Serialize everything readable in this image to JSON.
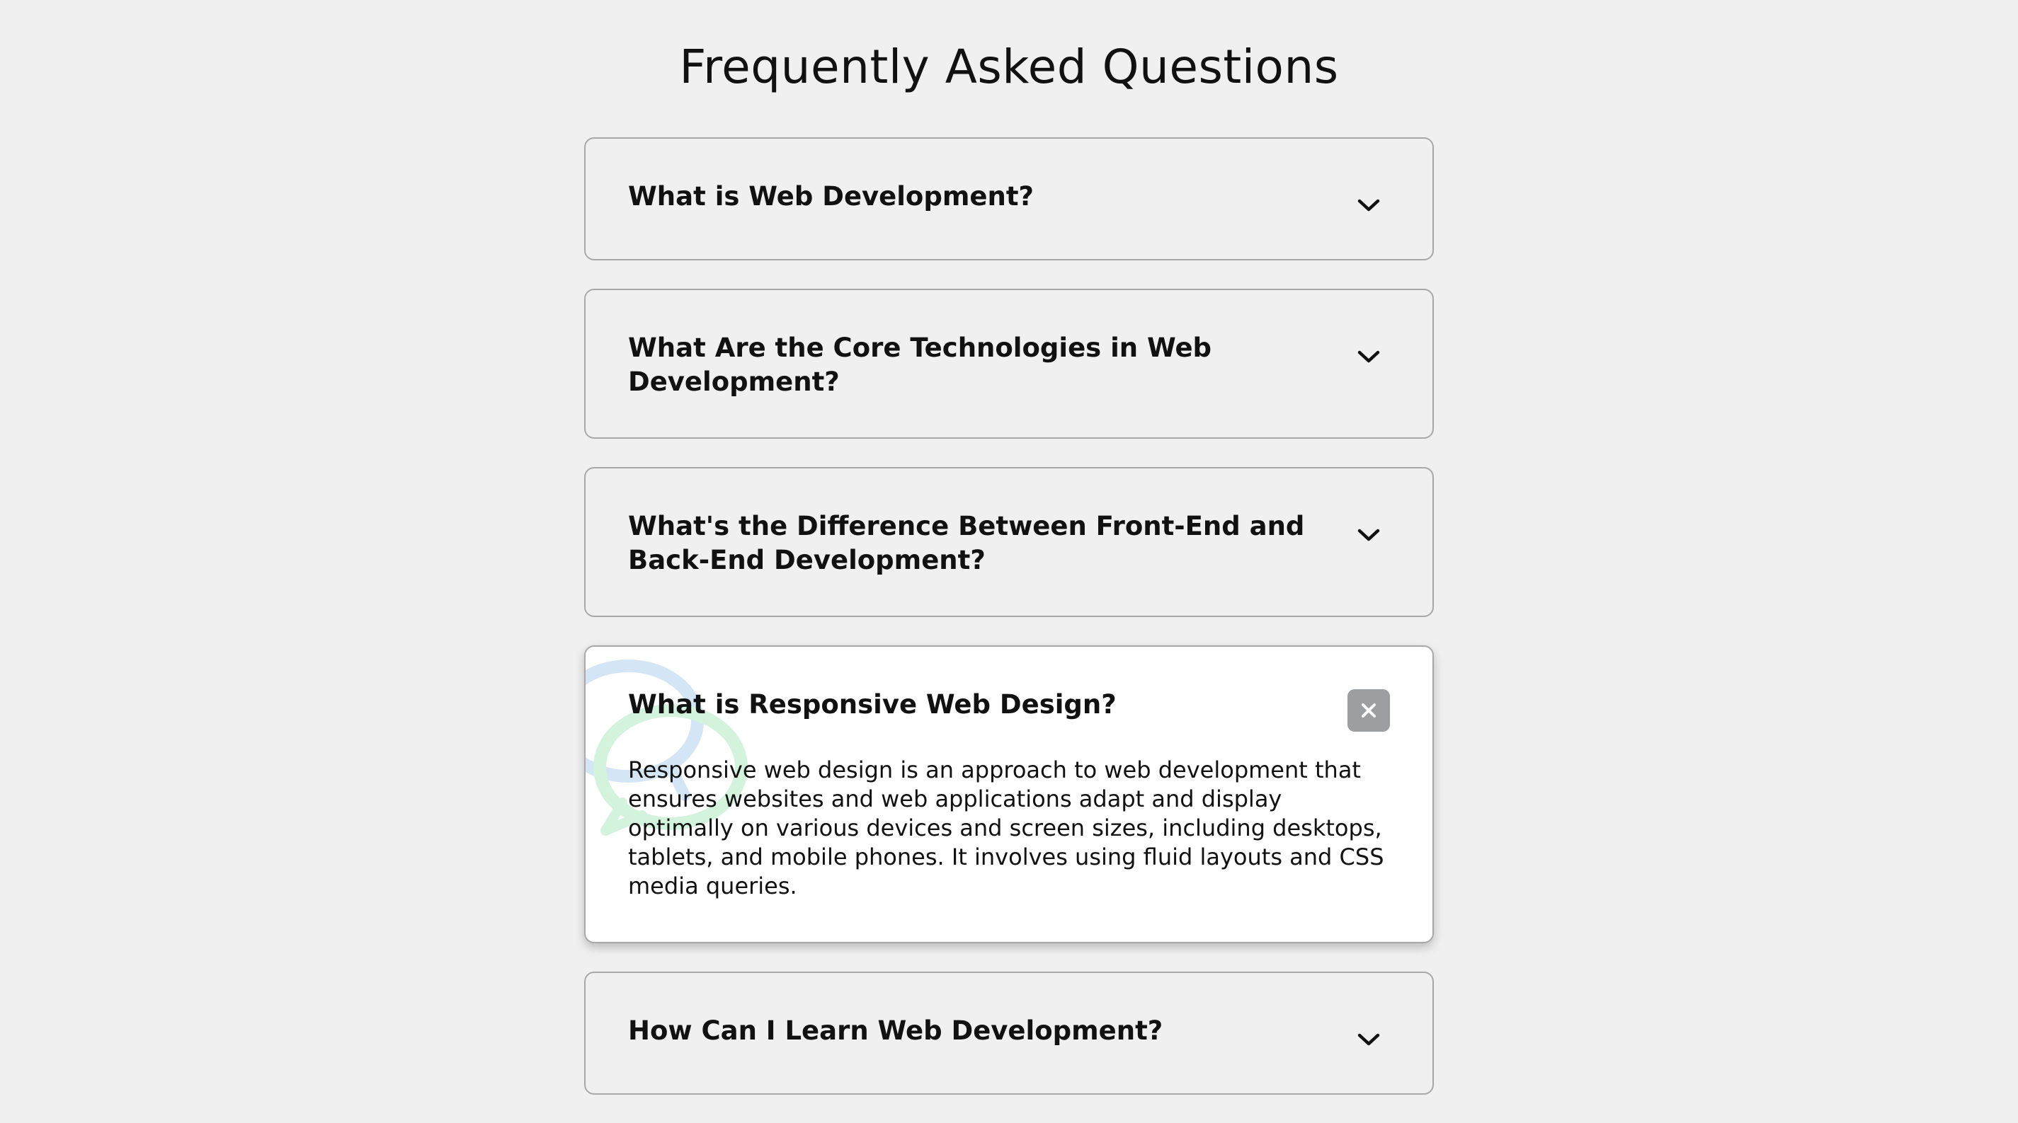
{
  "page": {
    "title": "Frequently Asked Questions"
  },
  "faqs": [
    {
      "question": "What is Web Development?",
      "state": "collapsed",
      "icon": "chevron-down-icon"
    },
    {
      "question": "What Are the Core Technologies in Web Development?",
      "state": "collapsed",
      "icon": "chevron-down-icon"
    },
    {
      "question": "What's the Difference Between Front-End and Back-End Development?",
      "state": "collapsed",
      "icon": "chevron-down-icon"
    },
    {
      "question": "What is Responsive Web Design?",
      "state": "expanded",
      "icon": "close-icon",
      "answer": "Responsive web design is an approach to web development that ensures websites and web applications adapt and display optimally on various devices and screen sizes, including desktops, tablets, and mobile phones. It involves using fluid layouts and CSS media queries."
    },
    {
      "question": "How Can I Learn Web Development?",
      "state": "collapsed",
      "icon": "chevron-down-icon"
    }
  ],
  "decoration": {
    "icon": "chat-bubbles-icon",
    "colors": [
      "#d4e6f6",
      "#d3f3dd"
    ]
  },
  "colors": {
    "page_background": "#f0f0f0",
    "card_background": "#f0f0f0",
    "open_card_background": "#ffffff",
    "card_border": "#a8a8a8",
    "close_button": "#9b9fa1"
  }
}
